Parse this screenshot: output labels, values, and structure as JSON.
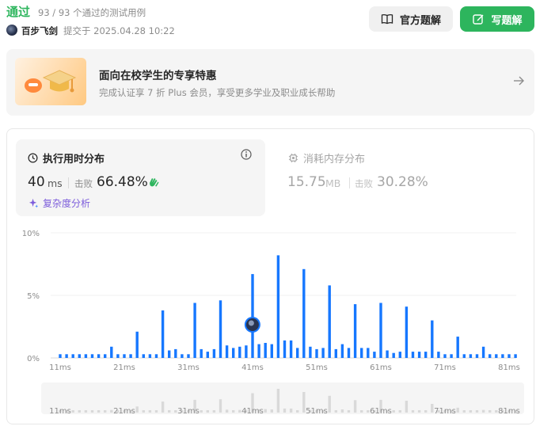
{
  "header": {
    "status": "通过",
    "cases": "93 / 93 个通过的测试用例",
    "username": "百步飞剑",
    "submit_info": "提交于 2025.04.28 10:22",
    "official_btn": "官方题解",
    "write_btn": "写题解"
  },
  "promo": {
    "title": "面向在校学生的专享特惠",
    "subtitle": "完成认证享 7 折 Plus 会员，享受更多学业及职业成长帮助"
  },
  "runtime": {
    "title": "执行用时分布",
    "value": "40",
    "unit": "ms",
    "beats_label": "击败",
    "beats": "66.48%",
    "complexity": "复杂度分析"
  },
  "memory": {
    "title": "消耗内存分布",
    "value": "15.75",
    "unit": "MB",
    "beats_label": "击败",
    "beats": "30.28%"
  },
  "colors": {
    "accent_green": "#2db55d",
    "bar_blue": "#1677ff",
    "purple": "#7c5cdb"
  },
  "chart_data": {
    "type": "bar",
    "xlabel": "",
    "ylabel": "",
    "y_tick_labels": [
      "0%",
      "5%",
      "10%"
    ],
    "ylim": [
      0,
      10
    ],
    "x_tick_labels": [
      "11ms",
      "21ms",
      "31ms",
      "41ms",
      "51ms",
      "61ms",
      "71ms",
      "81ms"
    ],
    "x_start": 11,
    "x_step": 1,
    "values": [
      0.3,
      0.3,
      0.3,
      0.3,
      0.3,
      0.3,
      0.3,
      0.3,
      0.9,
      0.3,
      0.3,
      0.3,
      2.1,
      0.3,
      0.3,
      0.3,
      3.8,
      0.6,
      0.7,
      0.3,
      0.3,
      4.4,
      0.7,
      0.5,
      0.7,
      4.6,
      1.0,
      0.8,
      0.9,
      1.0,
      6.7,
      1.1,
      1.2,
      1.1,
      8.2,
      1.4,
      1.4,
      0.8,
      7.1,
      0.9,
      0.7,
      0.8,
      5.8,
      0.7,
      1.1,
      0.8,
      4.3,
      0.8,
      0.8,
      0.5,
      4.4,
      0.6,
      0.4,
      0.5,
      4.1,
      0.5,
      0.5,
      0.5,
      3.0,
      0.5,
      0.3,
      0.3,
      1.7,
      0.3,
      0.3,
      0.3,
      0.9,
      0.3,
      0.3,
      0.3,
      0.3,
      0.3
    ],
    "highlight_x": 40,
    "grid": true,
    "legend": "none"
  }
}
